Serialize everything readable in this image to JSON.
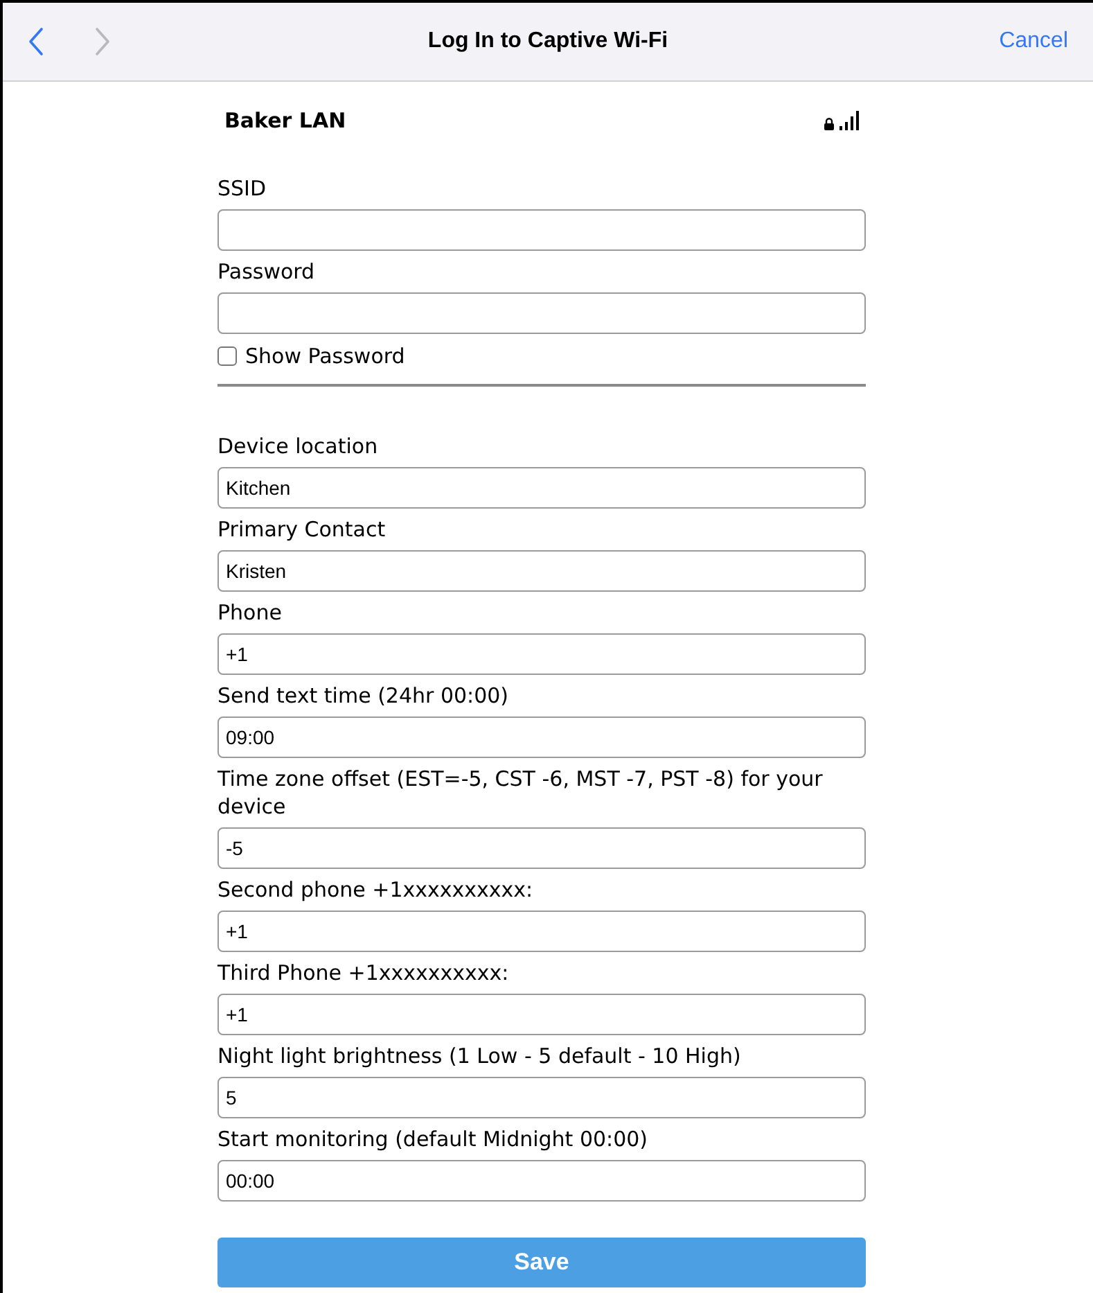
{
  "header": {
    "title": "Log In to Captive Wi-Fi",
    "cancel": "Cancel",
    "back": {
      "disabled": false
    },
    "forward": {
      "disabled": true
    }
  },
  "network": {
    "name": "Baker LAN",
    "secured": true
  },
  "credentials": [
    {
      "label": "SSID"
    },
    {
      "label": "Password"
    }
  ],
  "show_password": {
    "label": "Show Password",
    "checked": false
  },
  "fields": [
    {
      "label": "Device location",
      "value": "Kitchen"
    },
    {
      "label": "Primary Contact",
      "value": "Kristen"
    },
    {
      "label": "Phone",
      "value": "+1"
    },
    {
      "label": "Send text time (24hr 00:00)",
      "value": "09:00"
    },
    {
      "label": "Time zone offset (EST=-5, CST -6, MST -7, PST -8) for your device",
      "value": "-5"
    },
    {
      "label": "Second phone +1xxxxxxxxxx:",
      "value": "+1"
    },
    {
      "label": "Third Phone +1xxxxxxxxxx:",
      "value": "+1"
    },
    {
      "label": "Night light brightness (1 Low - 5 default - 10 High)",
      "value": "5"
    },
    {
      "label": "Start monitoring (default Midnight 00:00)",
      "value": "00:00"
    }
  ],
  "save": "Save"
}
